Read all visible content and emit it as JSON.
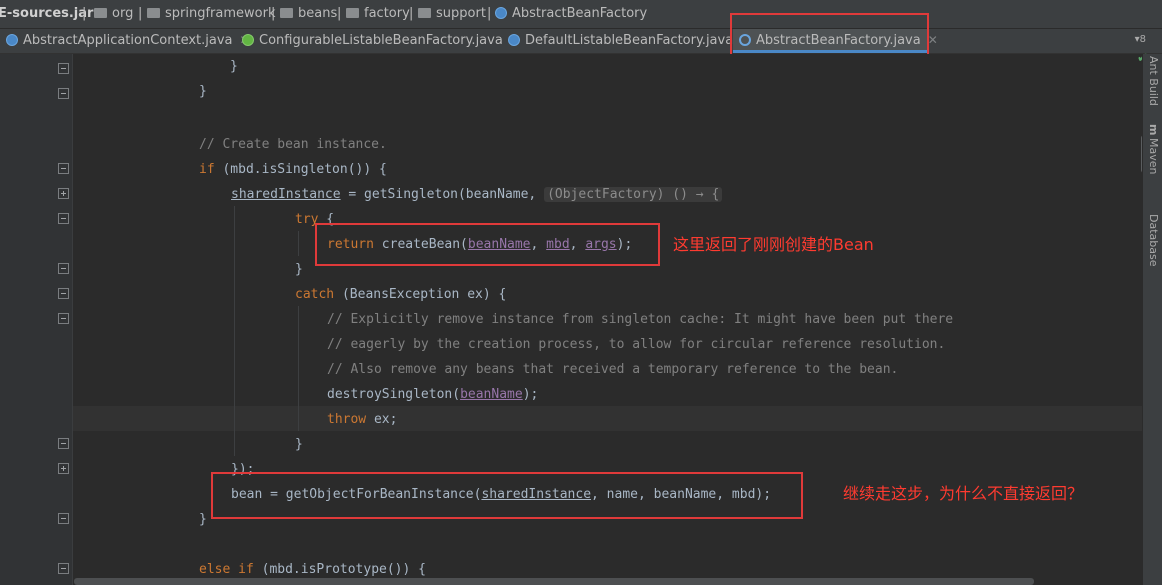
{
  "breadcrumb": {
    "items": [
      "E-sources.jar",
      "org",
      "springframework",
      "beans",
      "factory",
      "support",
      "AbstractBeanFactory"
    ]
  },
  "tabs": [
    {
      "label": "AbstractApplicationContext.java",
      "icon": "class-icon",
      "active": false
    },
    {
      "label": "ConfigurableListableBeanFactory.java",
      "icon": "interface-icon",
      "active": false
    },
    {
      "label": "DefaultListableBeanFactory.java",
      "icon": "class-icon",
      "active": false
    },
    {
      "label": "AbstractBeanFactory.java",
      "icon": "abstract-class-icon",
      "active": true
    }
  ],
  "tab_overflow": "▾8",
  "side_panels": [
    "Ant Build",
    "m",
    "Maven",
    "Database"
  ],
  "code": {
    "l1": "}",
    "l2": "}",
    "l4": "// Create bean instance.",
    "l5_kw": "if",
    "l5_rest": " (mbd.isSingleton()) {",
    "l6_var": "sharedInstance",
    "l6_mid": " = getSingleton(beanName, ",
    "l6_hint": "(ObjectFactory) () → {",
    "l7_kw": "try",
    "l7_rest": " {",
    "l8_kw": "return",
    "l8_a": " createBean(",
    "l8_p1": "beanName",
    "l8_s1": ", ",
    "l8_p2": "mbd",
    "l8_s2": ", ",
    "l8_p3": "args",
    "l8_end": ");",
    "l9": "}",
    "l10_kw": "catch",
    "l10_rest": " (BeansException ex) {",
    "l11": "// Explicitly remove instance from singleton cache: It might have been put there",
    "l12": "// eagerly by the creation process, to allow for circular reference resolution.",
    "l13": "// Also remove any beans that received a temporary reference to the bean.",
    "l14_a": "destroySingleton(",
    "l14_p": "beanName",
    "l14_end": ");",
    "l15_kw": "throw",
    "l15_rest": " ex;",
    "l16": "}",
    "l17": "});",
    "l18_a": "bean = getObjectForBeanInstance(",
    "l18_u": "sharedInstance",
    "l18_end": ", name, beanName, mbd);",
    "l19": "}",
    "l21_kw1": "else",
    "l21_sp": " ",
    "l21_kw2": "if",
    "l21_rest": " (mbd.isPrototype()) {"
  },
  "annotations": {
    "return_note": "这里返回了刚刚创建的Bean",
    "continue_note": "继续走这步，为什么不直接返回？"
  },
  "colors": {
    "keyword": "#cc7832",
    "comment": "#808080",
    "param": "#9876aa",
    "text": "#a9b7c6",
    "annotation": "#e03a3a"
  }
}
